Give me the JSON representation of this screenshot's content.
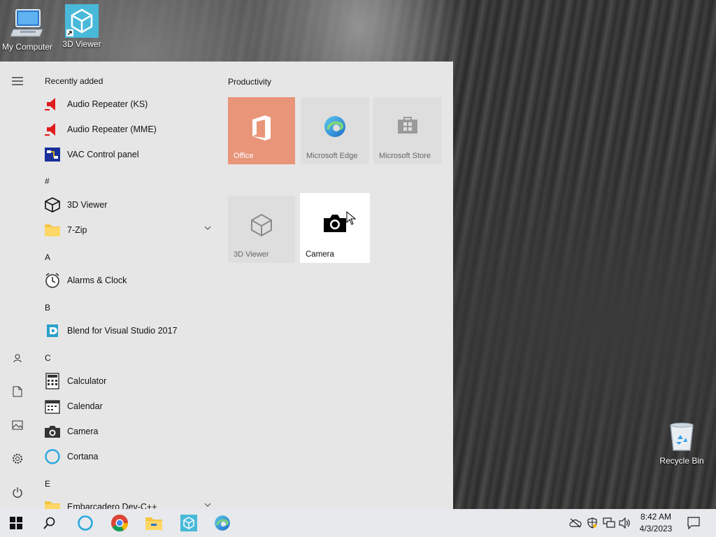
{
  "desktop": {
    "icons": [
      {
        "label": "My Computer",
        "icon": "computer-icon"
      },
      {
        "label": "3D Viewer",
        "icon": "cube-icon"
      },
      {
        "label": "Recycle Bin",
        "icon": "recycle-bin-icon"
      }
    ]
  },
  "start_menu": {
    "recently_added_heading": "Recently added",
    "recent": [
      "Audio Repeater (KS)",
      "Audio Repeater (MME)",
      "VAC Control panel"
    ],
    "sections": [
      {
        "letter": "#",
        "items": [
          "3D Viewer",
          "7-Zip"
        ]
      },
      {
        "letter": "A",
        "items": [
          "Alarms & Clock"
        ]
      },
      {
        "letter": "B",
        "items": [
          "Blend for Visual Studio 2017"
        ]
      },
      {
        "letter": "C",
        "items": [
          "Calculator",
          "Calendar",
          "Camera",
          "Cortana"
        ]
      },
      {
        "letter": "E",
        "items": [
          "Embarcadero Dev-C++"
        ]
      }
    ],
    "tiles_group": "Productivity",
    "tiles": [
      "Office",
      "Microsoft Edge",
      "Microsoft Store",
      "3D Viewer",
      "Camera"
    ],
    "tile_colors": {
      "office": "#e8957a",
      "default": "#dedede",
      "hover": "#ffffff"
    }
  },
  "taskbar": {
    "time": "8:42 AM",
    "date": "4/3/2023",
    "pinned": [
      "start-icon",
      "search-icon",
      "cortana-icon",
      "chrome-icon",
      "file-explorer-icon",
      "3d-viewer-icon",
      "edge-icon"
    ]
  }
}
